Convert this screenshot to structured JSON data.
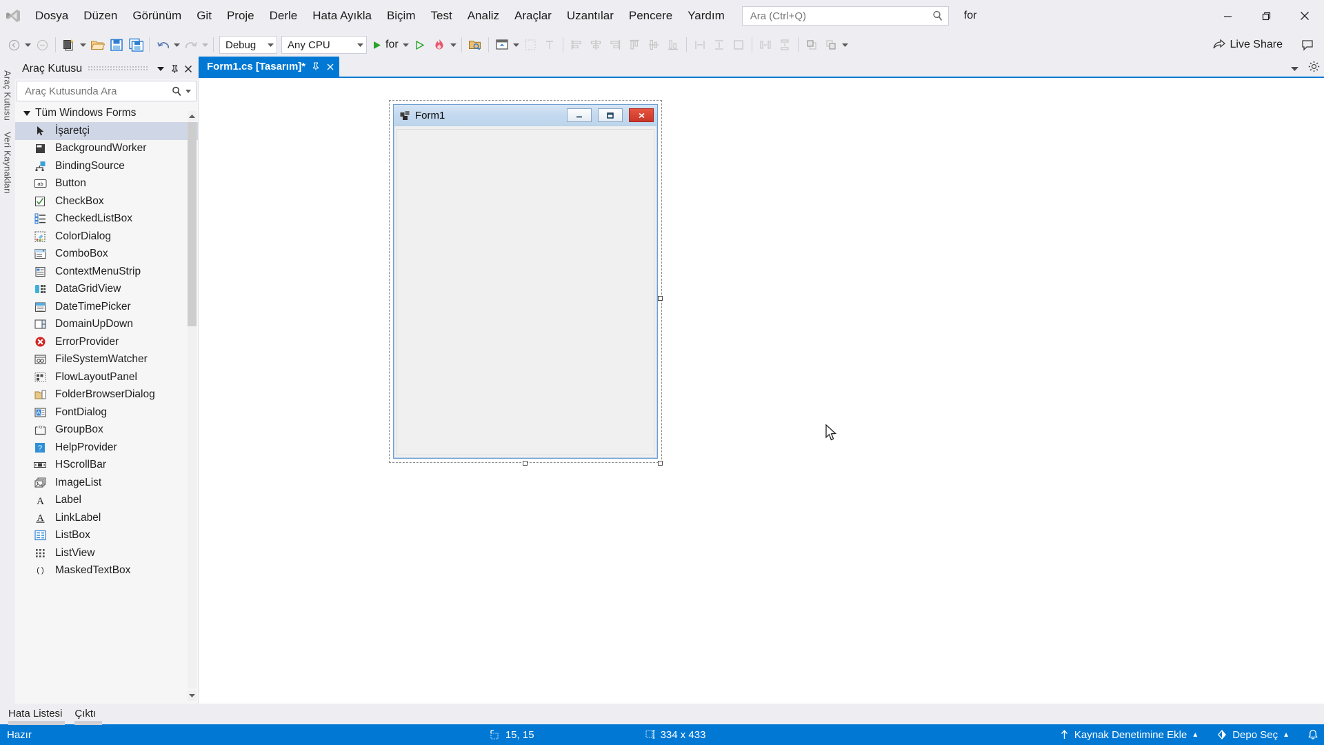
{
  "window": {
    "minimize_icon": "minimize-icon",
    "restore_icon": "restore-icon",
    "close_icon": "close-icon"
  },
  "menubar": {
    "logo_icon": "visual-studio-logo-icon",
    "items": [
      "Dosya",
      "Düzen",
      "Görünüm",
      "Git",
      "Proje",
      "Derle",
      "Hata Ayıkla",
      "Biçim",
      "Test",
      "Analiz",
      "Araçlar",
      "Uzantılar",
      "Pencere",
      "Yardım"
    ],
    "search": {
      "placeholder": "Ara (Ctrl+Q)",
      "value": "",
      "icon": "search-icon"
    },
    "project_label": "for"
  },
  "toolbar": {
    "nav_back_icon": "navigate-back-icon",
    "nav_forward_icon": "navigate-forward-icon",
    "new_project_icon": "new-project-icon",
    "open_file_icon": "open-file-icon",
    "save_icon": "save-icon",
    "save_all_icon": "save-all-icon",
    "undo_icon": "undo-icon",
    "redo_icon": "redo-icon",
    "configuration": "Debug",
    "platform": "Any CPU",
    "start_label": "for",
    "start_icon": "start-debug-icon",
    "start_no_debug_icon": "start-without-debugging-icon",
    "hot_reload_icon": "hot-reload-icon",
    "solution_explorer_icon": "solution-explorer-icon",
    "properties_window_icon": "properties-window-icon",
    "tab_order_icon": "tab-order-icon",
    "align_lefts_icon": "align-lefts-icon",
    "align_centers_icon": "align-centers-icon",
    "align_rights_icon": "align-rights-icon",
    "align_tops_icon": "align-tops-icon",
    "align_middles_icon": "align-middles-icon",
    "align_bottoms_icon": "align-bottoms-icon",
    "make_same_width_icon": "make-same-width-icon",
    "make_same_height_icon": "make-same-height-icon",
    "make_same_size_icon": "make-same-size-icon",
    "horizontal_spacing_icon": "horizontal-spacing-icon",
    "vertical_spacing_icon": "vertical-spacing-icon",
    "bring_to_front_icon": "bring-to-front-icon",
    "send_to_back_icon": "send-to-back-icon",
    "live_share_label": "Live Share",
    "live_share_icon": "live-share-icon",
    "feedback_icon": "send-feedback-icon"
  },
  "left_strip": {
    "labels": [
      "Araç Kutusu",
      "Veri Kaynakları"
    ]
  },
  "toolbox": {
    "title": "Araç Kutusu",
    "dropdown_icon": "chevron-down-icon",
    "pin_icon": "pin-icon",
    "close_icon": "close-icon",
    "search_placeholder": "Araç Kutusunda Ara",
    "search_value": "",
    "search_icon": "search-icon",
    "search_dropdown_icon": "chevron-down-icon",
    "category": "Tüm Windows Forms",
    "selected_item": "İşaretçi",
    "items": [
      {
        "label": "İşaretçi",
        "icon": "pointer-icon"
      },
      {
        "label": "BackgroundWorker",
        "icon": "background-worker-icon"
      },
      {
        "label": "BindingSource",
        "icon": "binding-source-icon"
      },
      {
        "label": "Button",
        "icon": "button-icon"
      },
      {
        "label": "CheckBox",
        "icon": "checkbox-icon"
      },
      {
        "label": "CheckedListBox",
        "icon": "checked-list-box-icon"
      },
      {
        "label": "ColorDialog",
        "icon": "color-dialog-icon"
      },
      {
        "label": "ComboBox",
        "icon": "combo-box-icon"
      },
      {
        "label": "ContextMenuStrip",
        "icon": "context-menu-strip-icon"
      },
      {
        "label": "DataGridView",
        "icon": "data-grid-view-icon"
      },
      {
        "label": "DateTimePicker",
        "icon": "date-time-picker-icon"
      },
      {
        "label": "DomainUpDown",
        "icon": "domain-up-down-icon"
      },
      {
        "label": "ErrorProvider",
        "icon": "error-provider-icon"
      },
      {
        "label": "FileSystemWatcher",
        "icon": "file-system-watcher-icon"
      },
      {
        "label": "FlowLayoutPanel",
        "icon": "flow-layout-panel-icon"
      },
      {
        "label": "FolderBrowserDialog",
        "icon": "folder-browser-dialog-icon"
      },
      {
        "label": "FontDialog",
        "icon": "font-dialog-icon"
      },
      {
        "label": "GroupBox",
        "icon": "group-box-icon"
      },
      {
        "label": "HelpProvider",
        "icon": "help-provider-icon"
      },
      {
        "label": "HScrollBar",
        "icon": "h-scroll-bar-icon"
      },
      {
        "label": "ImageList",
        "icon": "image-list-icon"
      },
      {
        "label": "Label",
        "icon": "label-icon"
      },
      {
        "label": "LinkLabel",
        "icon": "link-label-icon"
      },
      {
        "label": "ListBox",
        "icon": "list-box-icon"
      },
      {
        "label": "ListView",
        "icon": "list-view-icon"
      },
      {
        "label": "MaskedTextBox",
        "icon": "masked-text-box-icon"
      }
    ]
  },
  "document": {
    "tab_label": "Form1.cs [Tasarım]*",
    "tab_pin_icon": "pin-icon",
    "tab_close_icon": "close-icon",
    "strip_dropdown_icon": "chevron-down-icon",
    "strip_settings_icon": "gear-icon"
  },
  "form": {
    "title": "Form1",
    "app_icon": "form-app-icon",
    "minimize_icon": "minimize-icon",
    "maximize_icon": "maximize-icon",
    "close_icon": "close-icon"
  },
  "bottom_tabs": {
    "items": [
      "Hata Listesi",
      "Çıktı"
    ]
  },
  "statusbar": {
    "status": "Hazır",
    "position_icon": "position-icon",
    "position": "15, 15",
    "size_icon": "size-icon",
    "size": "334 x 433",
    "source_control_icon": "add-to-source-control-icon",
    "source_control": "Kaynak Denetimine Ekle",
    "repo_icon": "repository-icon",
    "repo": "Depo Seç",
    "notifications_icon": "bell-icon",
    "chevron_up_icon": "chevron-up-icon"
  },
  "colors": {
    "accent": "#0078d4",
    "titlebar_bg": "#eeeef2",
    "toolbox_bg": "#f6f6f6",
    "designer_bg": "#ffffff",
    "form_bg": "#f0f0f0",
    "close_red": "#c9372a"
  }
}
